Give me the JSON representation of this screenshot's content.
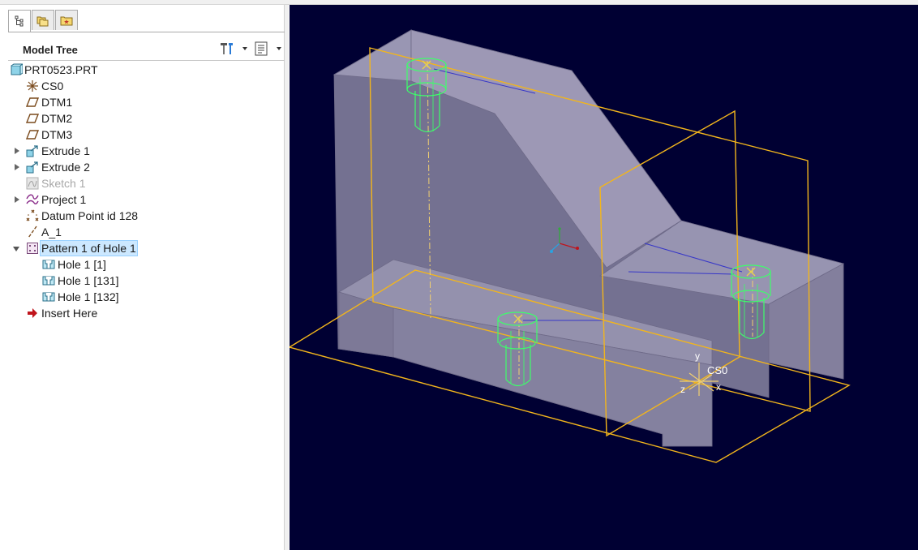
{
  "tabs": [
    {
      "icon": "model-tree-icon",
      "active": true
    },
    {
      "icon": "folder-browser-icon",
      "active": false
    },
    {
      "icon": "favorites-icon",
      "active": false
    }
  ],
  "model_tree": {
    "title": "Model Tree",
    "items": [
      {
        "label": "PRT0523.PRT",
        "icon": "part-icon",
        "level": 0,
        "expander": "none"
      },
      {
        "label": "CS0",
        "icon": "coordinate-system-icon",
        "level": 1,
        "expander": "none"
      },
      {
        "label": "DTM1",
        "icon": "datum-plane-icon",
        "level": 1,
        "expander": "none"
      },
      {
        "label": "DTM2",
        "icon": "datum-plane-icon",
        "level": 1,
        "expander": "none"
      },
      {
        "label": "DTM3",
        "icon": "datum-plane-icon",
        "level": 1,
        "expander": "none"
      },
      {
        "label": "Extrude 1",
        "icon": "extrude-icon",
        "level": 1,
        "expander": "closed"
      },
      {
        "label": "Extrude 2",
        "icon": "extrude-icon",
        "level": 1,
        "expander": "closed"
      },
      {
        "label": "Sketch 1",
        "icon": "sketch-icon",
        "level": 1,
        "expander": "none",
        "dimmed": true
      },
      {
        "label": "Project 1",
        "icon": "project-curve-icon",
        "level": 1,
        "expander": "closed"
      },
      {
        "label": "Datum Point id 128",
        "icon": "datum-point-icon",
        "level": 1,
        "expander": "none"
      },
      {
        "label": "A_1",
        "icon": "datum-axis-icon",
        "level": 1,
        "expander": "none"
      },
      {
        "label": "Pattern 1 of Hole 1",
        "icon": "pattern-icon",
        "level": 1,
        "expander": "open",
        "selected": true
      },
      {
        "label": "Hole 1 [1]",
        "icon": "hole-icon",
        "level": 2,
        "expander": "none"
      },
      {
        "label": "Hole 1 [131]",
        "icon": "hole-icon",
        "level": 2,
        "expander": "none"
      },
      {
        "label": "Hole 1 [132]",
        "icon": "hole-icon",
        "level": 2,
        "expander": "none"
      },
      {
        "label": "Insert Here",
        "icon": "insert-here-arrow-icon",
        "level": 1,
        "expander": "none"
      }
    ]
  },
  "viewport": {
    "csys_label": "CS0",
    "axis_labels": {
      "x": "x",
      "y": "y",
      "z": "z"
    },
    "colors": {
      "background": "#000033",
      "body": "#8e8aa6",
      "datum_plane": "#f2b51c",
      "hole_edges": "#3dff6a",
      "highlight": "#e8d24a"
    }
  }
}
